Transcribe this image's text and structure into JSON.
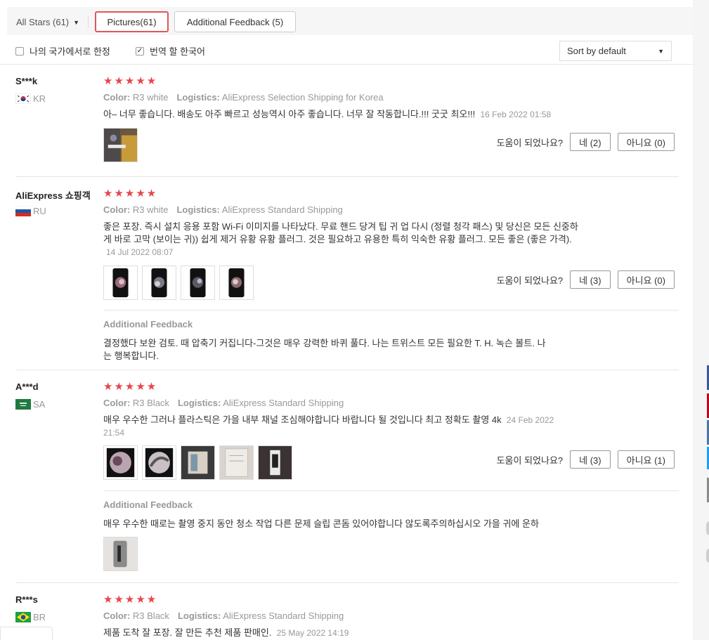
{
  "filters": {
    "all_stars": "All Stars (61)",
    "pictures_tab": "Pictures(61)",
    "additional_tab": "Additional Feedback (5)",
    "local_only_label": "나의 국가에서로 한정",
    "local_only_checked": false,
    "translate_label": "번역 할 한국어",
    "translate_checked": true,
    "sort": "Sort by default"
  },
  "labels": {
    "color": "Color:",
    "logistics": "Logistics:",
    "helpful_q": "도움이 되었나요?",
    "additional_feedback": "Additional Feedback"
  },
  "reviews": [
    {
      "user": "S***k",
      "country": "KR",
      "stars": "★★★★★",
      "color": "R3 white",
      "logistics": "AliExpress Selection Shipping for Korea",
      "text": "아– 너무 좋습니다. 배송도 아주 빠르고 성능역시 아주 좋습니다. 너무 잘 작동합니다.!!! 굿굿 최오!!!",
      "date": "16 Feb 2022 01:58",
      "yes": "네 (2)",
      "no": "아니요 (0)"
    },
    {
      "user": "AliExpress 쇼핑객",
      "country": "RU",
      "stars": "★★★★★",
      "color": "R3 white",
      "logistics": "AliExpress Standard Shipping",
      "text_line1": "좋은 포장. 즉시 설치 응용 포함 Wi-Fi 이미지를 나타났다. 무료 핸드 당겨 팁 귀 업 다시 (정렬 청각 패스) 및 당신은 모든 신중하",
      "text_line2": "게 바로 고막 (보이는 귀)) 쉽게 제거 유황 유황 플러그. 것은 필요하고 유용한 특히 익숙한 유황 플러그. 모든 좋은 (좋은 가격).",
      "date": "14 Jul 2022 08:07",
      "yes": "네 (3)",
      "no": "아니요 (0)",
      "additional_line1": "결정했다 보완 검토. 때 압축기 커집니다-그것은 매우 강력한 바퀴 풀다. 나는 트위스트 모든 필요한 T. H. 녹슨 볼트. 나",
      "additional_line2": "는 행복합니다."
    },
    {
      "user": "A***d",
      "country": "SA",
      "stars": "★★★★★",
      "color": "R3 Black",
      "logistics": "AliExpress Standard Shipping",
      "text": "매우 우수한 그러나 플라스틱은 가을 내부 채널 조심해야합니다 바랍니다 될 것입니다 최고 정확도 촬영 4k",
      "date_part1": "24 Feb 2022",
      "date_part2": "21:54",
      "yes": "네 (3)",
      "no": "아니요 (1)",
      "additional": "매우 우수한 때로는 촬영 중지 동안 청소 작업 다른 문제 슬립 콘돔 있어야합니다 않도록주의하십시오 가을 귀에 운하"
    },
    {
      "user": "R***s",
      "country": "BR",
      "stars": "★★★★★",
      "color": "R3 Black",
      "logistics": "AliExpress Standard Shipping",
      "text": "제품 도착 잘 포장. 잘 만든 추천 제품 판매인.",
      "date": "25 May 2022 14:19"
    }
  ],
  "colors": {
    "accent": "#e0565b",
    "star": "#e8454a",
    "muted": "#999999"
  },
  "icons": [
    "chevron-down-icon",
    "checkbox-icon",
    "flag-icon",
    "star-icon",
    "photo-thumbnail"
  ]
}
